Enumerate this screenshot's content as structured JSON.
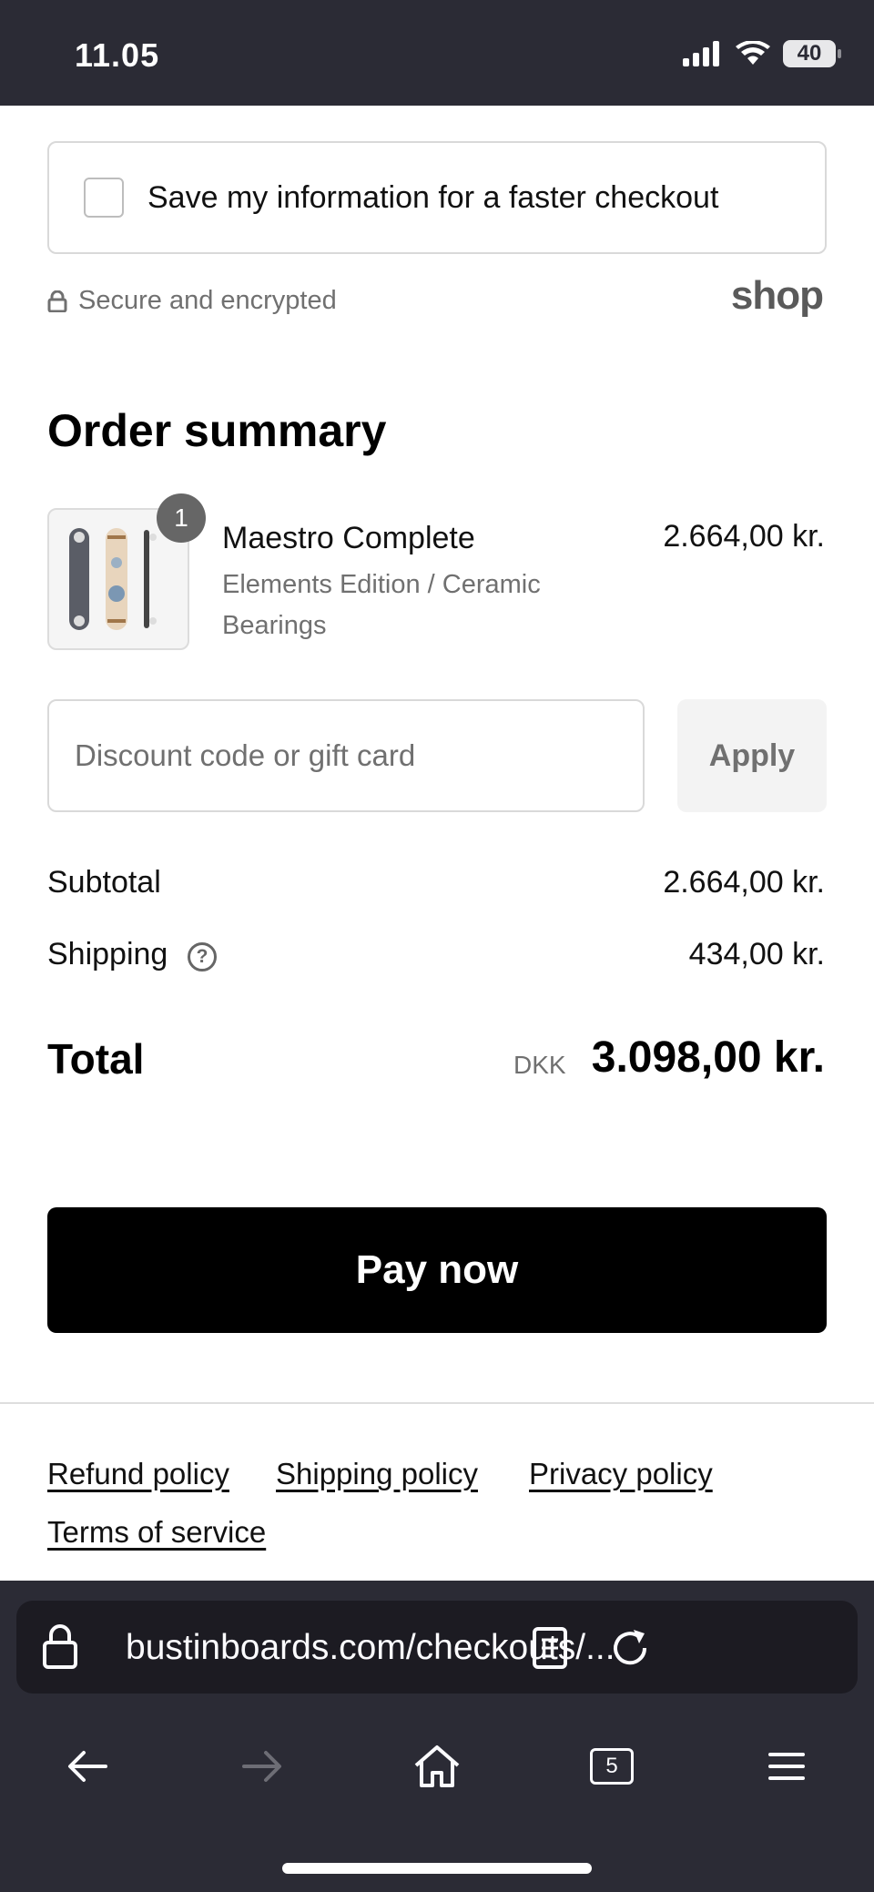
{
  "status_bar": {
    "time": "11.05",
    "battery": "40"
  },
  "save_info": {
    "label": "Save my information for a faster checkout",
    "checked": false
  },
  "secure": {
    "text": "Secure and encrypted",
    "brand": "shop"
  },
  "order_summary": {
    "title": "Order summary",
    "item": {
      "quantity": "1",
      "name": "Maestro Complete",
      "variant": "Elements Edition / Ceramic Bearings",
      "price": "2.664,00 kr."
    }
  },
  "discount": {
    "placeholder": "Discount code or gift card",
    "button": "Apply"
  },
  "totals": {
    "subtotal_label": "Subtotal",
    "subtotal_value": "2.664,00 kr.",
    "shipping_label": "Shipping",
    "shipping_value": "434,00 kr.",
    "total_label": "Total",
    "currency": "DKK",
    "total_value": "3.098,00 kr."
  },
  "pay_button": "Pay now",
  "policies": [
    "Refund policy",
    "Shipping policy",
    "Privacy policy",
    "Terms of service"
  ],
  "browser": {
    "url": "bustinboards.com/checkouts/...",
    "tab_count": "5"
  },
  "colors": {
    "chrome": "#2b2b35",
    "button": "#000000",
    "muted_text": "#707070"
  }
}
